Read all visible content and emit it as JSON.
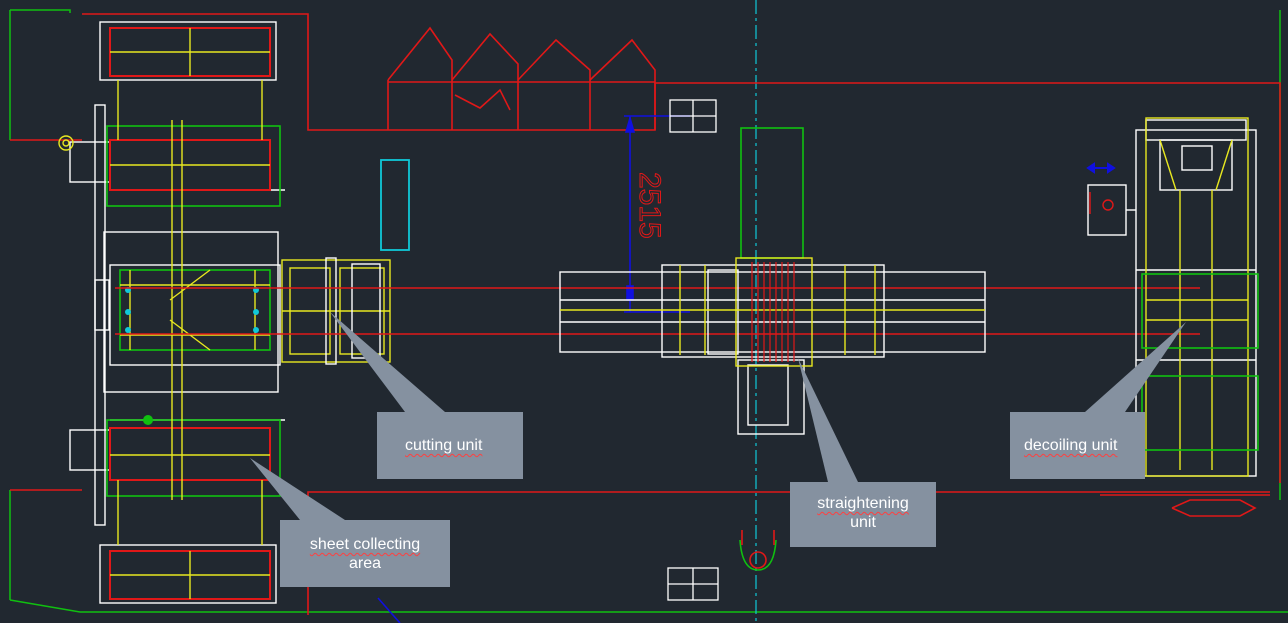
{
  "dimension_label": "2515",
  "labels": {
    "cutting": [
      "cutting unit"
    ],
    "straightening": [
      "straightening",
      "unit"
    ],
    "decoiling": [
      "decoiling unit"
    ],
    "sheet_collecting": [
      "sheet collecting",
      "area"
    ]
  },
  "colors": {
    "background": "#212830",
    "red": "#e01818",
    "yellow": "#e8e820",
    "white": "#ffffff",
    "green": "#10c010",
    "cyan": "#10c8d8",
    "blue": "#1010e0",
    "callout": "#8591a0"
  }
}
